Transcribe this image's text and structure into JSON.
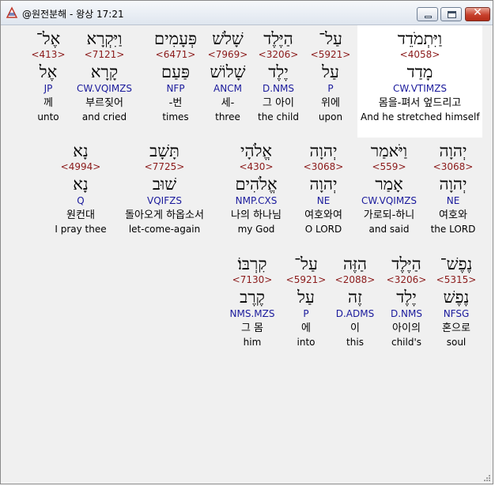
{
  "window": {
    "title": "@원전분해 - 왕상 17:21",
    "icon": "app-icon",
    "controls": {
      "minimize": "minimize-icon",
      "maximize": "maximize-icon",
      "close": "✕"
    }
  },
  "rows": [
    [
      {
        "hebrew": "וַיִּתְמֹדֵד",
        "strong": "<4058>",
        "lemma": "מָדַד",
        "parse": "CW.VTIMZS",
        "korean": "몸을-펴서 엎드리고",
        "english": "And he stretched himself",
        "highlighted": true
      },
      {
        "hebrew": "עַל־",
        "strong": "<5921>",
        "lemma": "עַל",
        "parse": "P",
        "korean": "위에",
        "english": "upon"
      },
      {
        "hebrew": "הַיֶּלֶד",
        "strong": "<3206>",
        "lemma": "יֶלֶד",
        "parse": "D.NMS",
        "korean": "그 아이",
        "english": "the child"
      },
      {
        "hebrew": "שָׁלֹשׁ",
        "strong": "<7969>",
        "lemma": "שָׁלוֹשׁ",
        "parse": "ANCM",
        "korean": "세-",
        "english": "three"
      },
      {
        "hebrew": "פְּעָמִים",
        "strong": "<6471>",
        "lemma": "פַּעַם",
        "parse": "NFP",
        "korean": "-번",
        "english": "times"
      },
      {
        "hebrew": "וַיִּקְרָא",
        "strong": "<7121>",
        "lemma": "קָרָא",
        "parse": "CW.VQIMZS",
        "korean": "부르짖어",
        "english": "and cried"
      },
      {
        "hebrew": "אֶל־",
        "strong": "<413>",
        "lemma": "אֶל",
        "parse": "JP",
        "korean": "께",
        "english": "unto"
      }
    ],
    [
      {
        "hebrew": "יְהוָה",
        "strong": "<3068>",
        "lemma": "יְהוָה",
        "parse": "NE",
        "korean": "여호와",
        "english": "the LORD"
      },
      {
        "hebrew": "וַיֹּאמַר",
        "strong": "<559>",
        "lemma": "אָמַר",
        "parse": "CW.VQIMZS",
        "korean": "가로되-하니",
        "english": "and said"
      },
      {
        "hebrew": "יְהוָה",
        "strong": "<3068>",
        "lemma": "יְהוָה",
        "parse": "NE",
        "korean": "여호와여",
        "english": "O LORD"
      },
      {
        "hebrew": "אֱלֹהָי",
        "strong": "<430>",
        "lemma": "אֱלֹהִים",
        "parse": "NMP.CXS",
        "korean": "나의 하나님",
        "english": "my God"
      },
      {
        "hebrew": "תָּשָׁב",
        "strong": "<7725>",
        "lemma": "שׁוּב",
        "parse": "VQIFZS",
        "korean": "돌아오게 하옵소서",
        "english": "let-come-again"
      },
      {
        "hebrew": "נָא",
        "strong": "<4994>",
        "lemma": "נָא",
        "parse": "Q",
        "korean": "원컨대",
        "english": "I pray thee"
      }
    ],
    [
      {
        "hebrew": "נֶפֶשׁ־",
        "strong": "<5315>",
        "lemma": "נֶפֶשׁ",
        "parse": "NFSG",
        "korean": "혼으로",
        "english": "soul"
      },
      {
        "hebrew": "הַיֶּלֶד",
        "strong": "<3206>",
        "lemma": "יֶלֶד",
        "parse": "D.NMS",
        "korean": "아이의",
        "english": "child's"
      },
      {
        "hebrew": "הַזֶּה",
        "strong": "<2088>",
        "lemma": "זֶה",
        "parse": "D.ADMS",
        "korean": "이",
        "english": "this"
      },
      {
        "hebrew": "עַל־",
        "strong": "<5921>",
        "lemma": "עַל",
        "parse": "P",
        "korean": "에",
        "english": "into"
      },
      {
        "hebrew": "קִרְבּוֹ׃",
        "strong": "<7130>",
        "lemma": "קֶרֶב",
        "parse": "NMS.MZS",
        "korean": "그 몸",
        "english": "him"
      }
    ]
  ]
}
